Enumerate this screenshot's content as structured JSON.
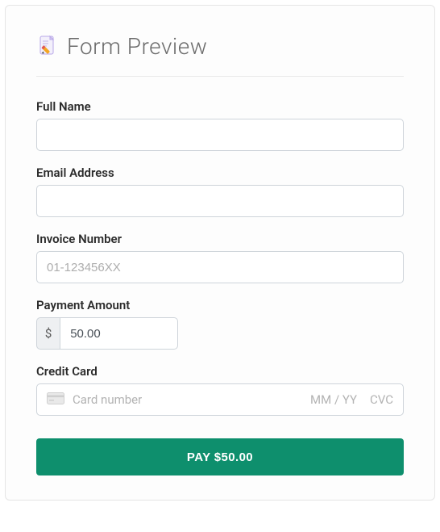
{
  "heading": "Form Preview",
  "fields": {
    "full_name": {
      "label": "Full Name",
      "value": ""
    },
    "email": {
      "label": "Email Address",
      "value": ""
    },
    "invoice": {
      "label": "Invoice Number",
      "placeholder": "01-123456XX",
      "value": ""
    },
    "amount": {
      "label": "Payment Amount",
      "currency_symbol": "$",
      "value": "50.00"
    },
    "credit_card": {
      "label": "Credit Card",
      "number_placeholder": "Card number",
      "expiry_placeholder": "MM / YY",
      "cvc_placeholder": "CVC"
    }
  },
  "button": {
    "label": "PAY $50.00"
  },
  "colors": {
    "accent": "#0e8f6d"
  }
}
